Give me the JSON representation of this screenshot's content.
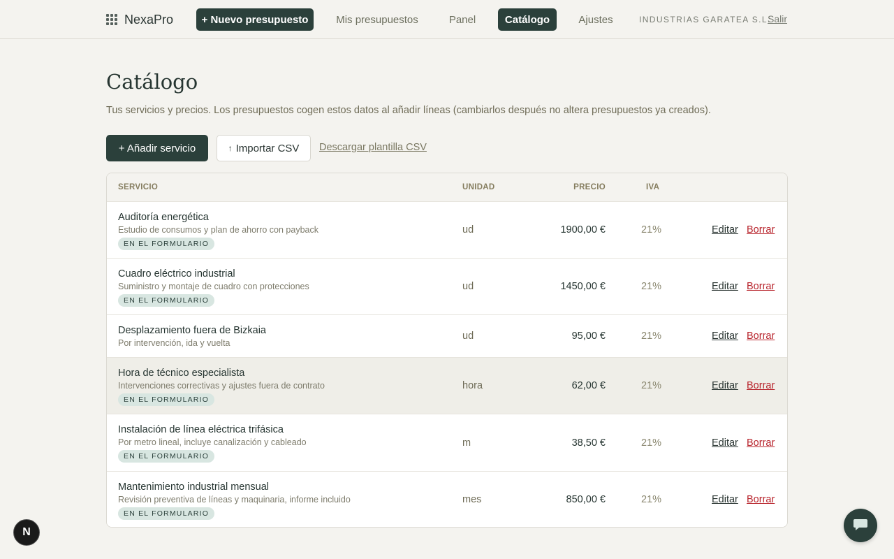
{
  "nav": {
    "brand": "NexaPro",
    "new_quote": "+ Nuevo presupuesto",
    "my_quotes": "Mis presupuestos",
    "panel": "Panel",
    "catalog": "Catálogo",
    "settings": "Ajustes",
    "company": "INDUSTRIAS GARATEA S.L.",
    "logout": "Salir"
  },
  "page": {
    "title": "Catálogo",
    "subtitle": "Tus servicios y precios. Los presupuestos cogen estos datos al añadir líneas (cambiarlos después no altera presupuestos ya creados)."
  },
  "actions": {
    "add_service": "+ Añadir servicio",
    "import_csv": "Importar CSV",
    "import_icon": "↑",
    "download_template": "Descargar plantilla CSV"
  },
  "table": {
    "headers": {
      "service": "SERVICIO",
      "unit": "UNIDAD",
      "price": "PRECIO",
      "iva": "IVA"
    },
    "edit_label": "Editar",
    "delete_label": "Borrar",
    "badge_label": "EN EL FORMULARIO",
    "rows": [
      {
        "name": "Auditoría energética",
        "desc": "Estudio de consumos y plan de ahorro con payback",
        "unit": "ud",
        "price": "1900,00 €",
        "iva": "21%",
        "in_form": true
      },
      {
        "name": "Cuadro eléctrico industrial",
        "desc": "Suministro y montaje de cuadro con protecciones",
        "unit": "ud",
        "price": "1450,00 €",
        "iva": "21%",
        "in_form": true
      },
      {
        "name": "Desplazamiento fuera de Bizkaia",
        "desc": "Por intervención, ida y vuelta",
        "unit": "ud",
        "price": "95,00 €",
        "iva": "21%",
        "in_form": false
      },
      {
        "name": "Hora de técnico especialista",
        "desc": "Intervenciones correctivas y ajustes fuera de contrato",
        "unit": "hora",
        "price": "62,00 €",
        "iva": "21%",
        "in_form": true
      },
      {
        "name": "Instalación de línea eléctrica trifásica",
        "desc": "Por metro lineal, incluye canalización y cableado",
        "unit": "m",
        "price": "38,50 €",
        "iva": "21%",
        "in_form": true
      },
      {
        "name": "Mantenimiento industrial mensual",
        "desc": "Revisión preventiva de líneas y maquinaria, informe incluido",
        "unit": "mes",
        "price": "850,00 €",
        "iva": "21%",
        "in_form": true
      }
    ]
  },
  "floating": {
    "dev_badge": "N",
    "chat_icon": "chat-bubble-icon"
  }
}
